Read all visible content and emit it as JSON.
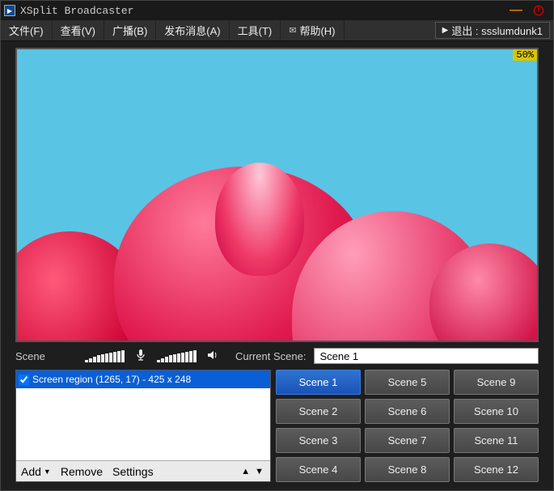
{
  "title": "XSplit Broadcaster",
  "menu": {
    "file": "文件(F)",
    "view": "查看(V)",
    "broadcast": "广播(B)",
    "publish": "发布消息(A)",
    "tools": "工具(T)",
    "help": "帮助(H)"
  },
  "logout": {
    "prefix": "▶",
    "label": "退出 : ssslumdunk1"
  },
  "preview": {
    "zoom": "50%"
  },
  "labels": {
    "scene": "Scene",
    "current_scene": "Current Scene:"
  },
  "current_scene": "Scene 1",
  "sources": [
    {
      "checked": true,
      "label": "Screen region (1265, 17) - 425 x 248",
      "selected": true
    }
  ],
  "source_bar": {
    "add": "Add",
    "remove": "Remove",
    "settings": "Settings"
  },
  "scenes": [
    "Scene 1",
    "Scene 2",
    "Scene 3",
    "Scene 4",
    "Scene 5",
    "Scene 6",
    "Scene 7",
    "Scene 8",
    "Scene 9",
    "Scene 10",
    "Scene 11",
    "Scene 12"
  ],
  "active_scene_index": 0
}
